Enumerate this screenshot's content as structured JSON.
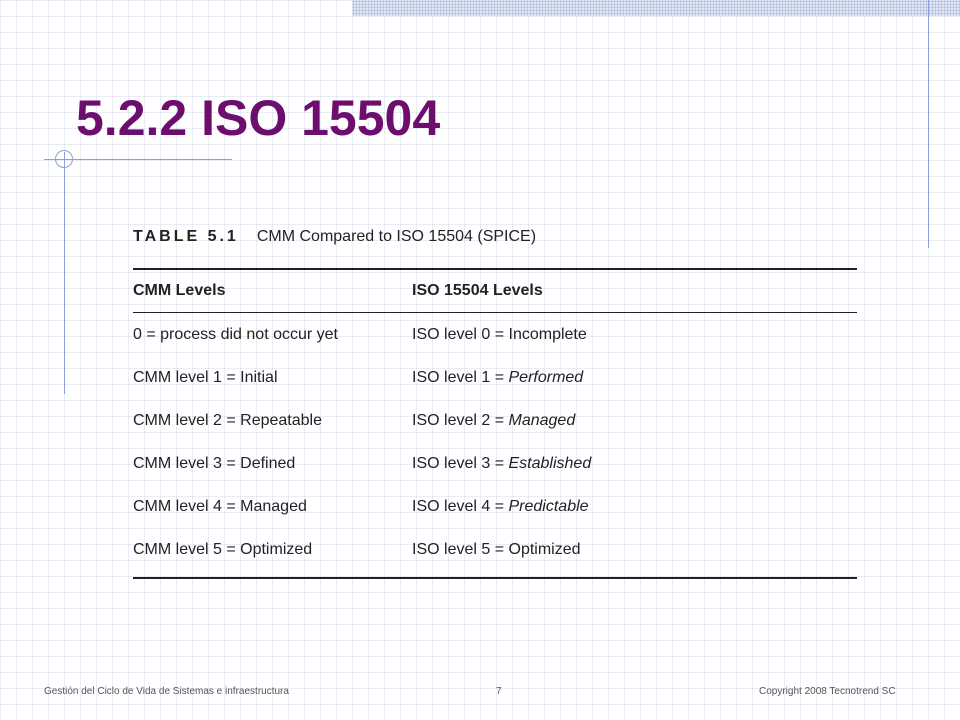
{
  "slide": {
    "title": "5.2.2 ISO 15504"
  },
  "table": {
    "label": "TABLE 5.1",
    "caption": "CMM Compared to ISO 15504 (SPICE)",
    "headers": [
      "CMM Levels",
      "ISO 15504 Levels"
    ],
    "rows": [
      {
        "cmm": "0 = process did not occur yet",
        "iso_prefix": "ISO level 0 = Incomplete",
        "iso_term": ""
      },
      {
        "cmm": "CMM level 1 = Initial",
        "iso_prefix": "ISO level 1 = ",
        "iso_term": "Performed"
      },
      {
        "cmm": "CMM level 2 = Repeatable",
        "iso_prefix": "ISO level 2 = ",
        "iso_term": "Managed"
      },
      {
        "cmm": "CMM level 3 = Defined",
        "iso_prefix": "ISO level 3 = ",
        "iso_term": "Established"
      },
      {
        "cmm": "CMM level 4 = Managed",
        "iso_prefix": "ISO level 4 = ",
        "iso_term": "Predictable"
      },
      {
        "cmm": "CMM level 5 = Optimized",
        "iso_prefix": "ISO level 5 = Optimized",
        "iso_term": ""
      }
    ]
  },
  "footer": {
    "left": "Gestión del Ciclo de Vida de Sistemas e infraestructura",
    "page": "7",
    "right": "Copyright  2008 Tecnotrend SC"
  },
  "colors": {
    "title": "#6d0e6f",
    "accent_lines": "#8fa0d4",
    "text": "#222222"
  }
}
